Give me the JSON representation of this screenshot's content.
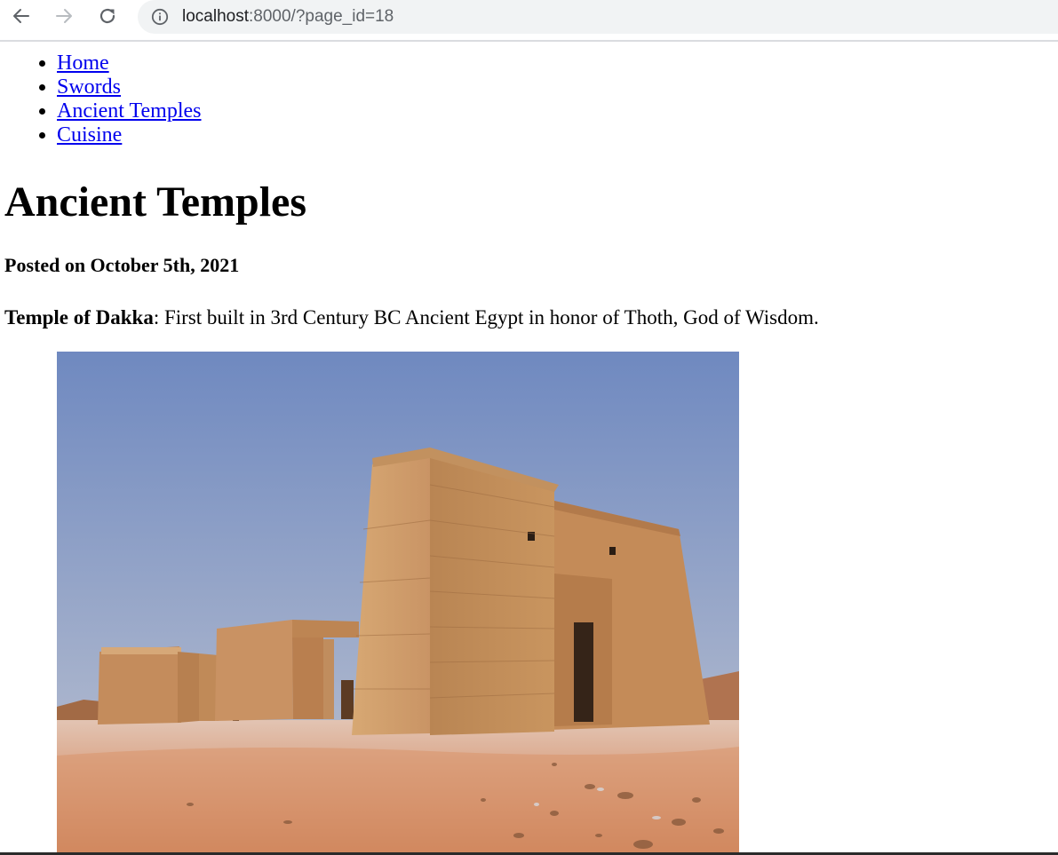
{
  "browser": {
    "url_host": "localhost",
    "url_path": ":8000/?page_id=18",
    "icons": {
      "back": "arrow-left-icon",
      "forward": "arrow-right-icon",
      "reload": "reload-icon",
      "site_info": "info-icon"
    }
  },
  "nav": {
    "items": [
      {
        "label": "Home"
      },
      {
        "label": "Swords"
      },
      {
        "label": "Ancient Temples"
      },
      {
        "label": "Cuisine"
      }
    ]
  },
  "article": {
    "title": "Ancient Temples",
    "posted": "Posted on October 5th, 2021",
    "temple_name": "Temple of Dakka",
    "temple_description": ": First built in 3rd Century BC Ancient Egypt in honor of Thoth, God of Wisdom."
  },
  "colors": {
    "link": "#0000ee",
    "omnibox_bg": "#f1f3f4",
    "sky": "#7f94c4",
    "sand": "#d9a07a",
    "stone": "#c48f5e"
  }
}
